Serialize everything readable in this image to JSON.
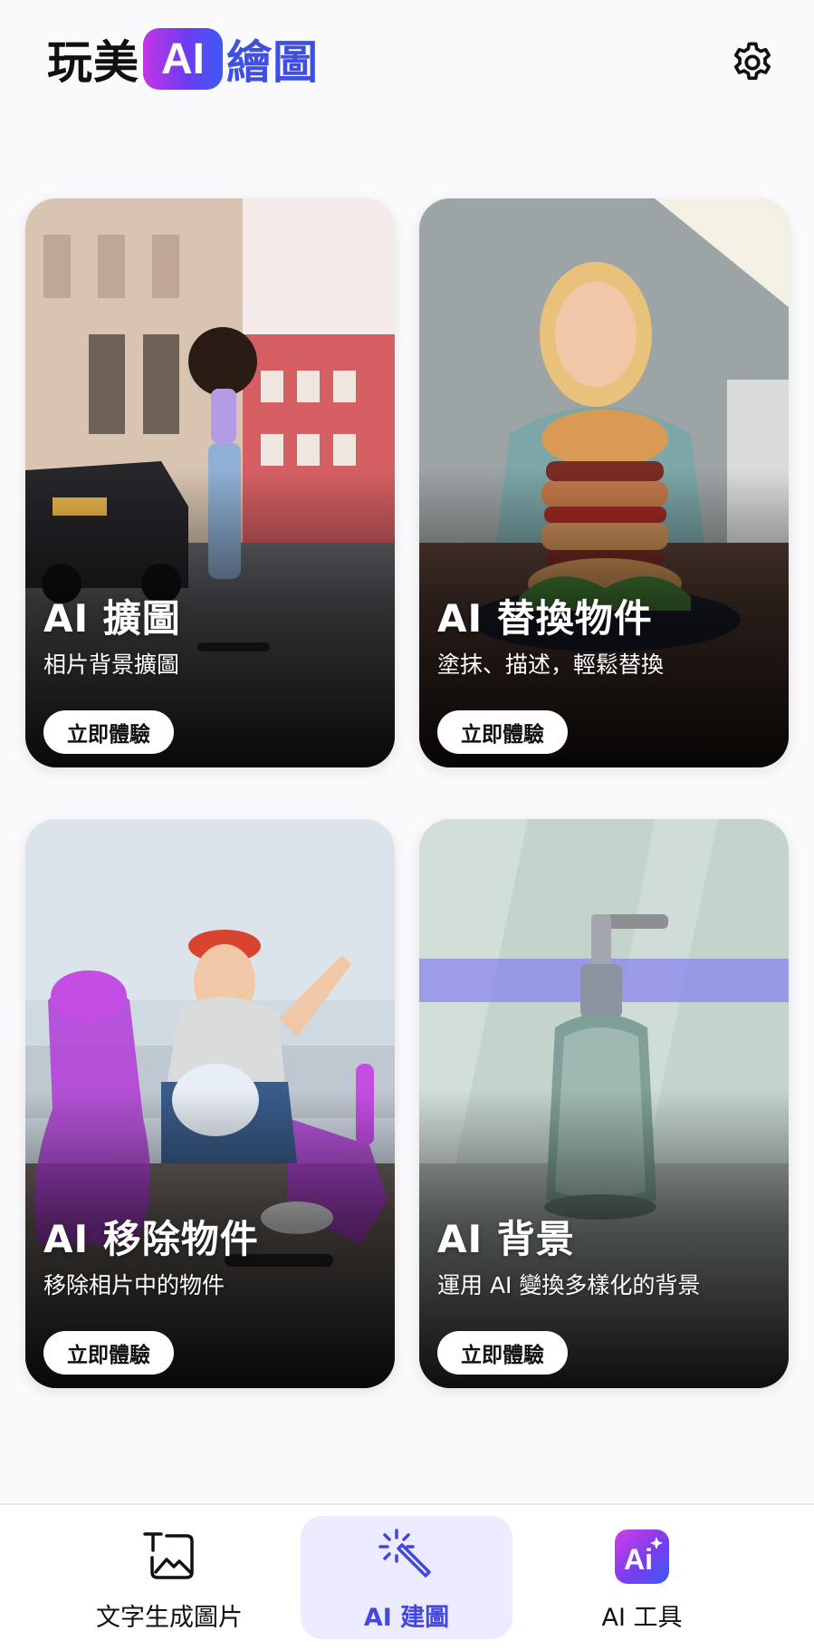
{
  "header": {
    "logo_prefix": "玩美",
    "logo_ai": "AI",
    "logo_suffix": "繪圖",
    "settings_icon": "gear-icon"
  },
  "cards": [
    {
      "title": "AI 擴圖",
      "subtitle": "相片背景擴圖",
      "button": "立即體驗",
      "image": "woman-skateboarding-street-photo"
    },
    {
      "title": "AI 替換物件",
      "subtitle": "塗抹、描述，輕鬆替換",
      "button": "立即體驗",
      "image": "woman-eating-giant-burger-photo"
    },
    {
      "title": "AI 移除物件",
      "subtitle": "移除相片中的物件",
      "button": "立即體驗",
      "image": "girls-with-purple-removal-mask-photo"
    },
    {
      "title": "AI 背景",
      "subtitle": "運用 AI 變換多樣化的背景",
      "button": "立即體驗",
      "image": "soap-bottle-with-scan-line-photo"
    }
  ],
  "bottom_nav": {
    "items": [
      {
        "label": "文字生成圖片",
        "icon": "text-to-image-icon",
        "active": false
      },
      {
        "label": "AI 建圖",
        "icon": "magic-wand-icon",
        "active": true
      },
      {
        "label": "AI 工具",
        "icon": "ai-tools-icon",
        "active": false
      }
    ]
  },
  "colors": {
    "accent": "#4348df",
    "active_pill": "#ecebff",
    "logo_gradient_start": "#c435e8",
    "logo_gradient_end": "#3b5bf5"
  }
}
